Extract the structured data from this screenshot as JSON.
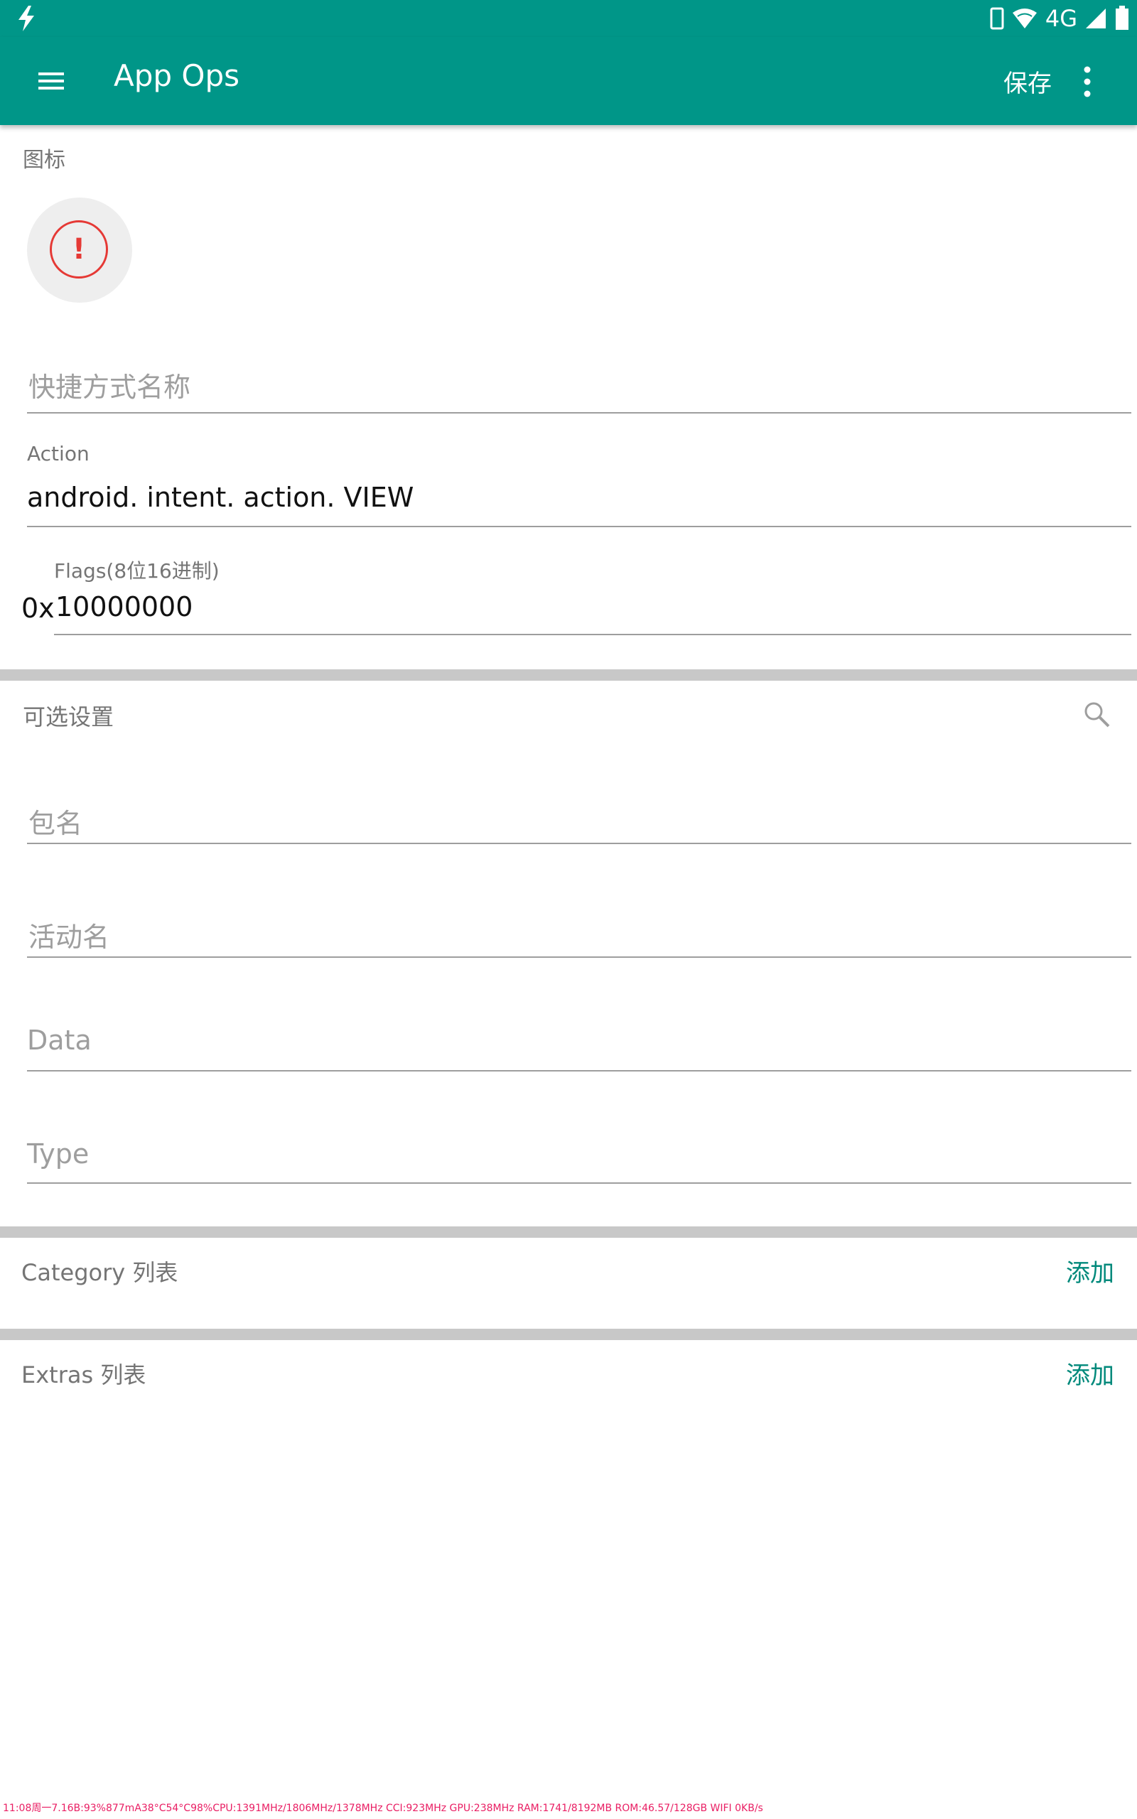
{
  "status_bar": {
    "network": "4G",
    "icons": [
      "bolt-icon",
      "phone-icon",
      "wifi-icon",
      "signal-icon",
      "battery-icon"
    ]
  },
  "app_bar": {
    "title": "App Ops",
    "save_label": "保存",
    "icons": [
      "menu-icon",
      "more-vert-icon"
    ]
  },
  "icon_section": {
    "label": "图标",
    "icon": "error-icon"
  },
  "form": {
    "shortcut_name_hint": "快捷方式名称",
    "action_label": "Action",
    "action_value": "android. intent. action. VIEW",
    "flags_label": "Flags(8位16进制)",
    "flags_prefix": "0x",
    "flags_value": "10000000"
  },
  "optional_settings": {
    "title": "可选设置",
    "search_icon": "search-icon",
    "package_hint": "包名",
    "activity_hint": "活动名",
    "data_hint": "Data",
    "type_hint": "Type"
  },
  "category": {
    "title": "Category 列表",
    "add_label": "添加"
  },
  "extras": {
    "title": "Extras 列表",
    "add_label": "添加"
  },
  "debug_overlay": "11:08周一7.16B:93%877mA38°C54°C98%CPU:1391MHz/1806MHz/1378MHz CCI:923MHz GPU:238MHz RAM:1741/8192MB ROM:46.57/128GB WIFI 0KB/s",
  "colors": {
    "primary": "#009688",
    "accent": "#00897b",
    "error": "#e53935"
  }
}
